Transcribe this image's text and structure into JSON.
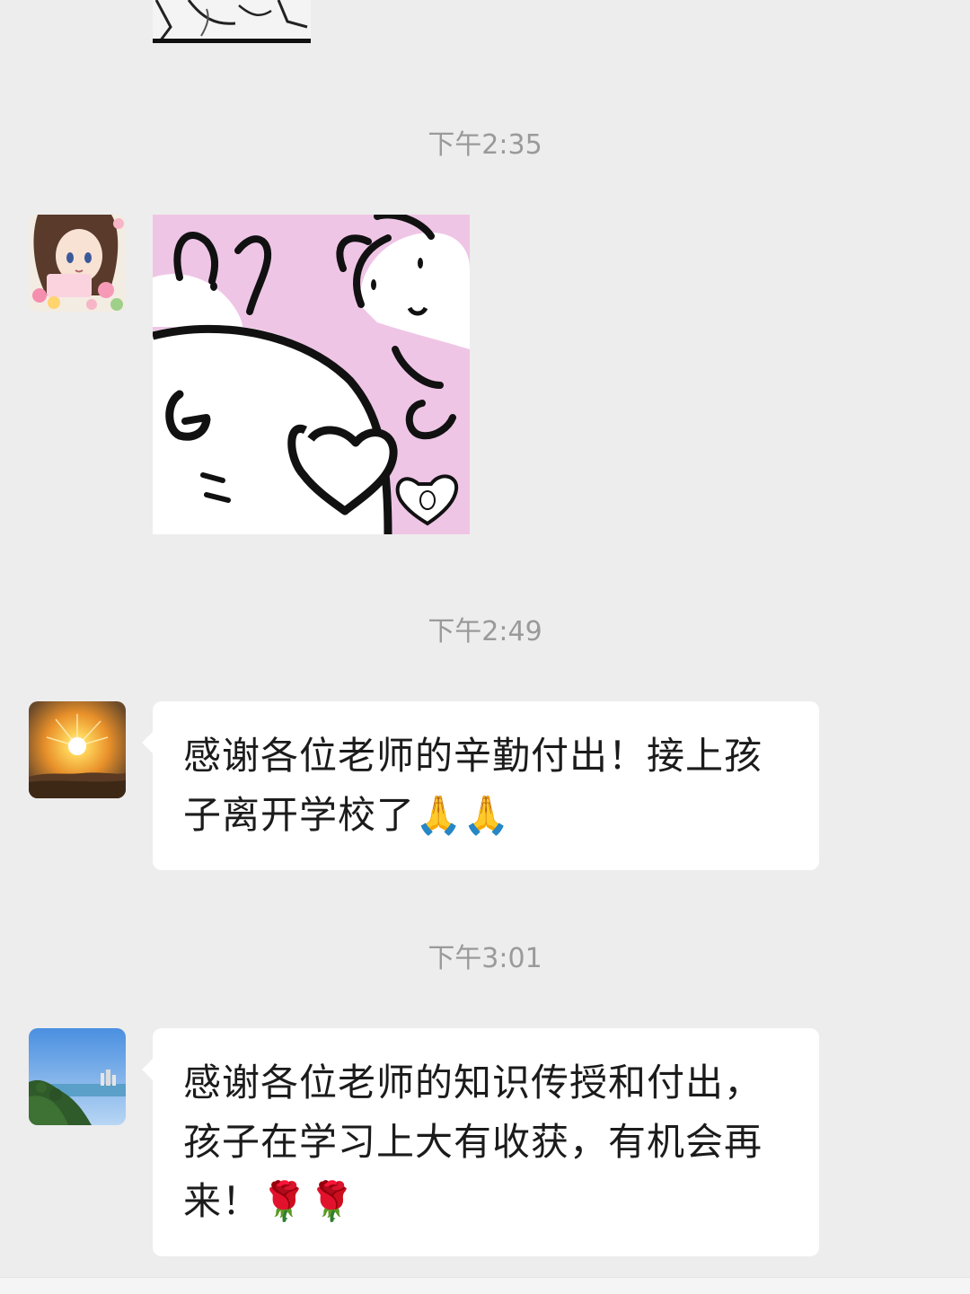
{
  "chat": {
    "timestamps": [
      "下午2:35",
      "下午2:49",
      "下午3:01"
    ],
    "messages": [
      {
        "type": "image",
        "content": "partial manga image (cropped at top)"
      },
      {
        "type": "image",
        "content": "cartoon sticker (pink background, white characters)"
      },
      {
        "type": "text",
        "text": "感谢各位老师的辛勤付出！接上孩子离开学校了🙏🙏"
      },
      {
        "type": "text",
        "text": "感谢各位老师的知识传授和付出，孩子在学习上大有收获，有机会再来！🌹🌹"
      }
    ]
  },
  "colors": {
    "background": "#ededed",
    "bubble": "#ffffff",
    "timestamp": "#9a9a9a",
    "text": "#1b1b1b"
  }
}
